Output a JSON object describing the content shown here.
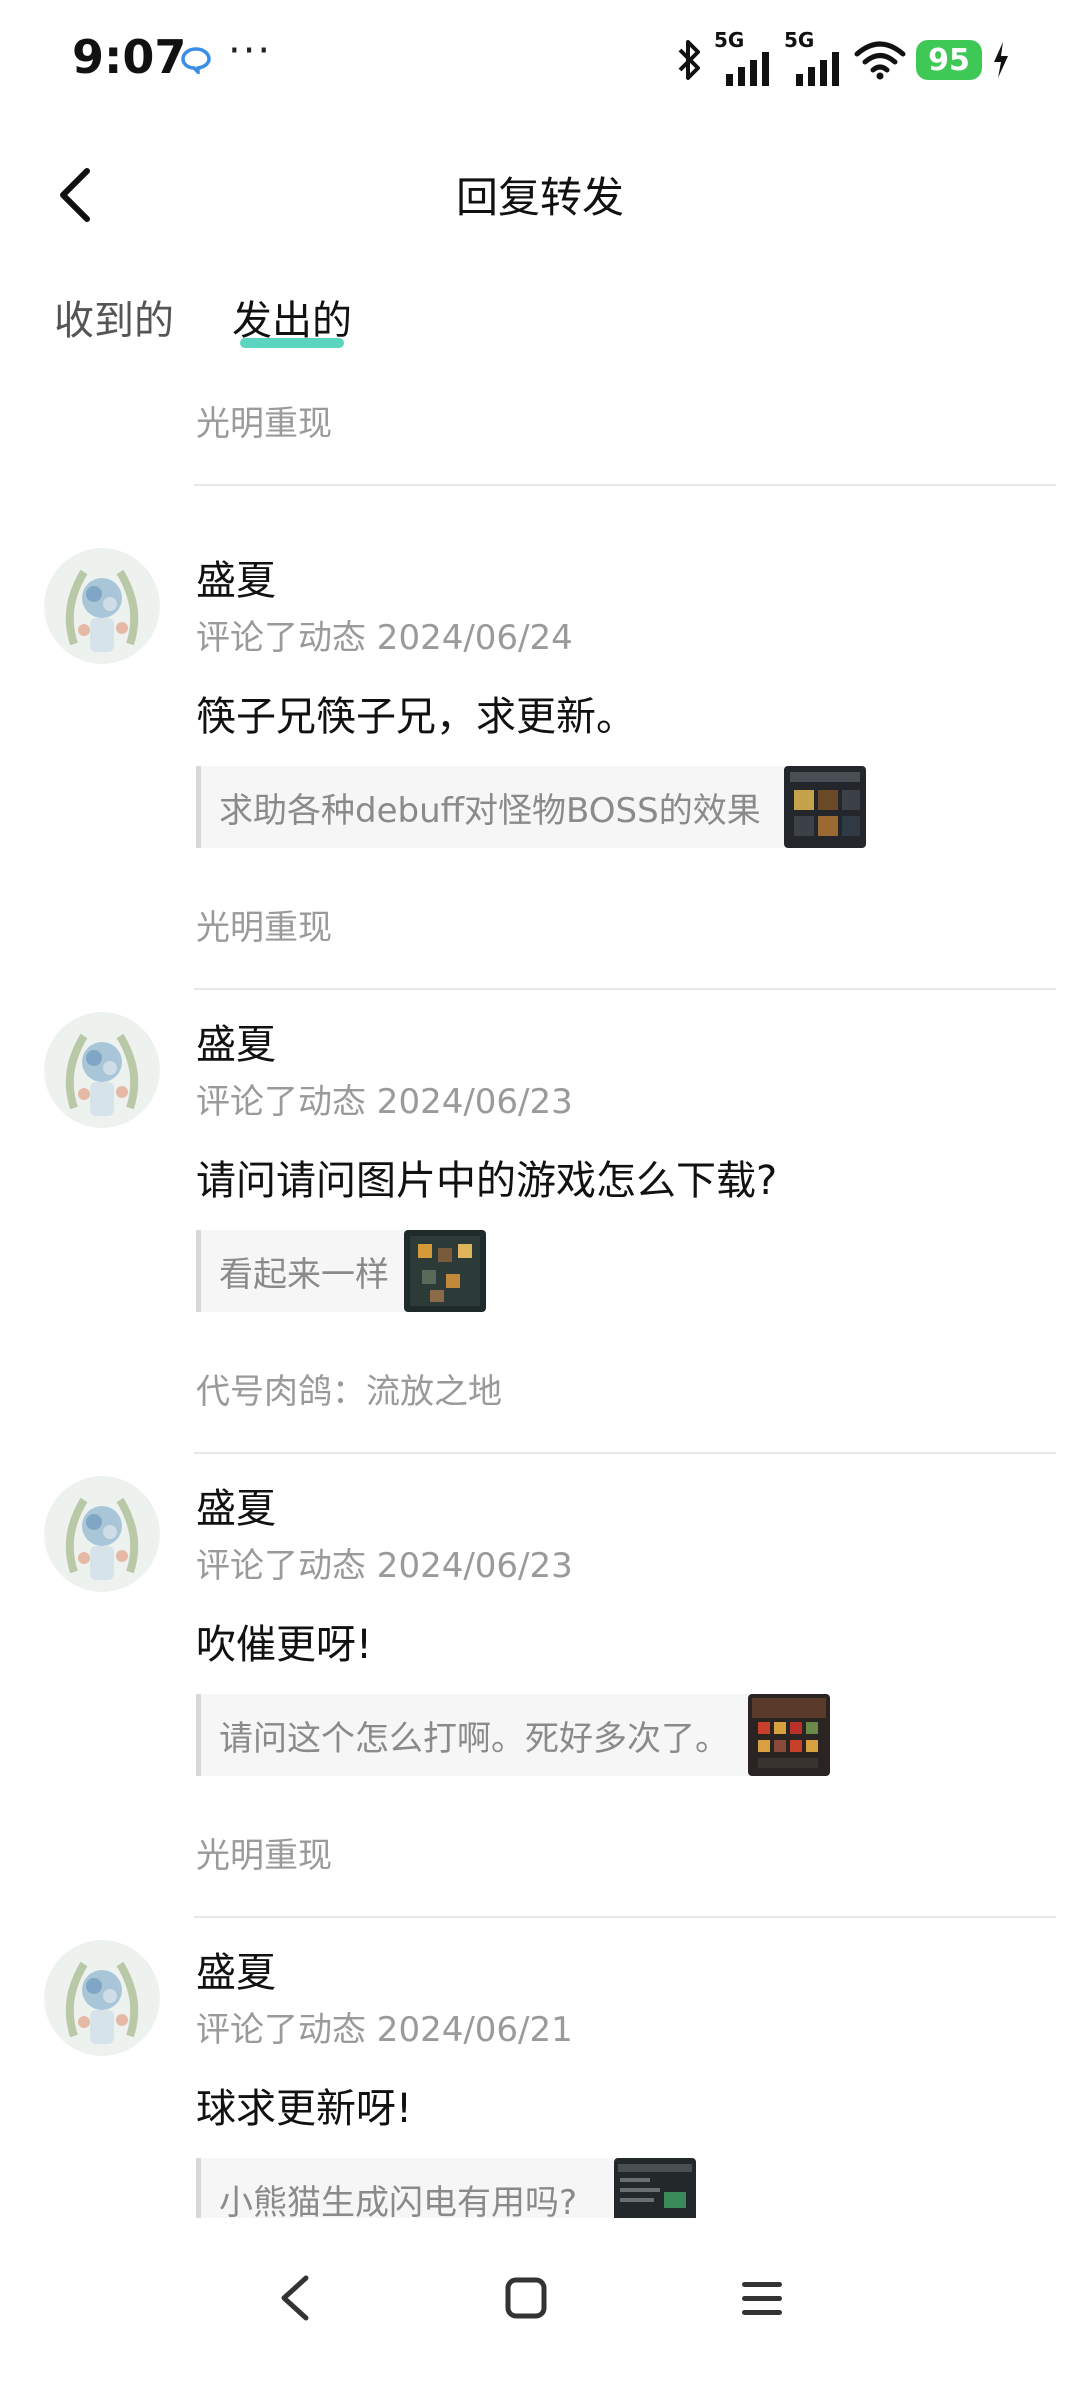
{
  "status_bar": {
    "time": "9:07",
    "more": "···",
    "signal1_label": "5G",
    "signal2_label": "5G",
    "battery": "95",
    "icons": [
      "chat-bubble-icon",
      "bluetooth-icon",
      "signal-icon",
      "wifi-icon",
      "battery-icon",
      "charging-icon"
    ]
  },
  "header": {
    "title": "回复转发",
    "back_icon": "chevron-left-icon"
  },
  "tabs": [
    {
      "label": "收到的",
      "active": false
    },
    {
      "label": "发出的",
      "active": true
    }
  ],
  "accent_color": "#5bd4c0",
  "list": {
    "partial_top_source": "光明重现",
    "items": [
      {
        "name": "盛夏",
        "meta": "评论了动态 2024/06/24",
        "comment": "筷子兄筷子兄，求更新。",
        "quote": "求助各种debuff对怪物BOSS的效果",
        "source": "光明重现"
      },
      {
        "name": "盛夏",
        "meta": "评论了动态 2024/06/23",
        "comment": "请问请问图片中的游戏怎么下载?",
        "quote": "看起来一样",
        "source": "代号肉鸽：流放之地"
      },
      {
        "name": "盛夏",
        "meta": "评论了动态 2024/06/23",
        "comment": "吹催更呀!",
        "quote": "请问这个怎么打啊。死好多次了。",
        "source": "光明重现"
      },
      {
        "name": "盛夏",
        "meta": "评论了动态 2024/06/21",
        "comment": "球求更新呀!",
        "quote": "小熊猫生成闪电有用吗?",
        "source": ""
      }
    ]
  },
  "nav_bar": {
    "icons": [
      "back-triangle-icon",
      "home-square-icon",
      "menu-lines-icon"
    ]
  }
}
